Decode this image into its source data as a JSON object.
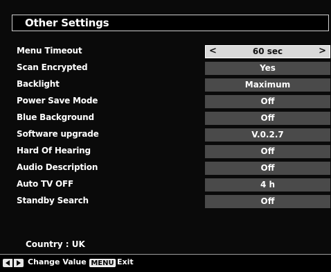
{
  "title": "Other Settings",
  "settings": [
    {
      "label": "Menu Timeout",
      "value": "60 sec"
    },
    {
      "label": "Scan Encrypted",
      "value": "Yes"
    },
    {
      "label": "Backlight",
      "value": "Maximum"
    },
    {
      "label": "Power Save Mode",
      "value": "Off"
    },
    {
      "label": "Blue Background",
      "value": "Off"
    },
    {
      "label": "Software upgrade",
      "value": "V.0.2.7"
    },
    {
      "label": "Hard Of Hearing",
      "value": "Off"
    },
    {
      "label": "Audio Description",
      "value": "Off"
    },
    {
      "label": "Auto TV OFF",
      "value": "4 h"
    },
    {
      "label": "Standby Search",
      "value": "Off"
    }
  ],
  "selected_index": 0,
  "arrows": {
    "left": "<",
    "right": ">"
  },
  "country": "Country : UK",
  "footer": {
    "change_value_label": "Change Value",
    "menu_key": "MENU",
    "exit_label": "Exit"
  },
  "icons": {
    "left_right_keys": "left-right-arrows-icon"
  },
  "colors": {
    "background": "#0a0a0a",
    "value_cell": "#4a4a4a",
    "selected_cell": "#d9d9d9",
    "text": "#ffffff"
  }
}
